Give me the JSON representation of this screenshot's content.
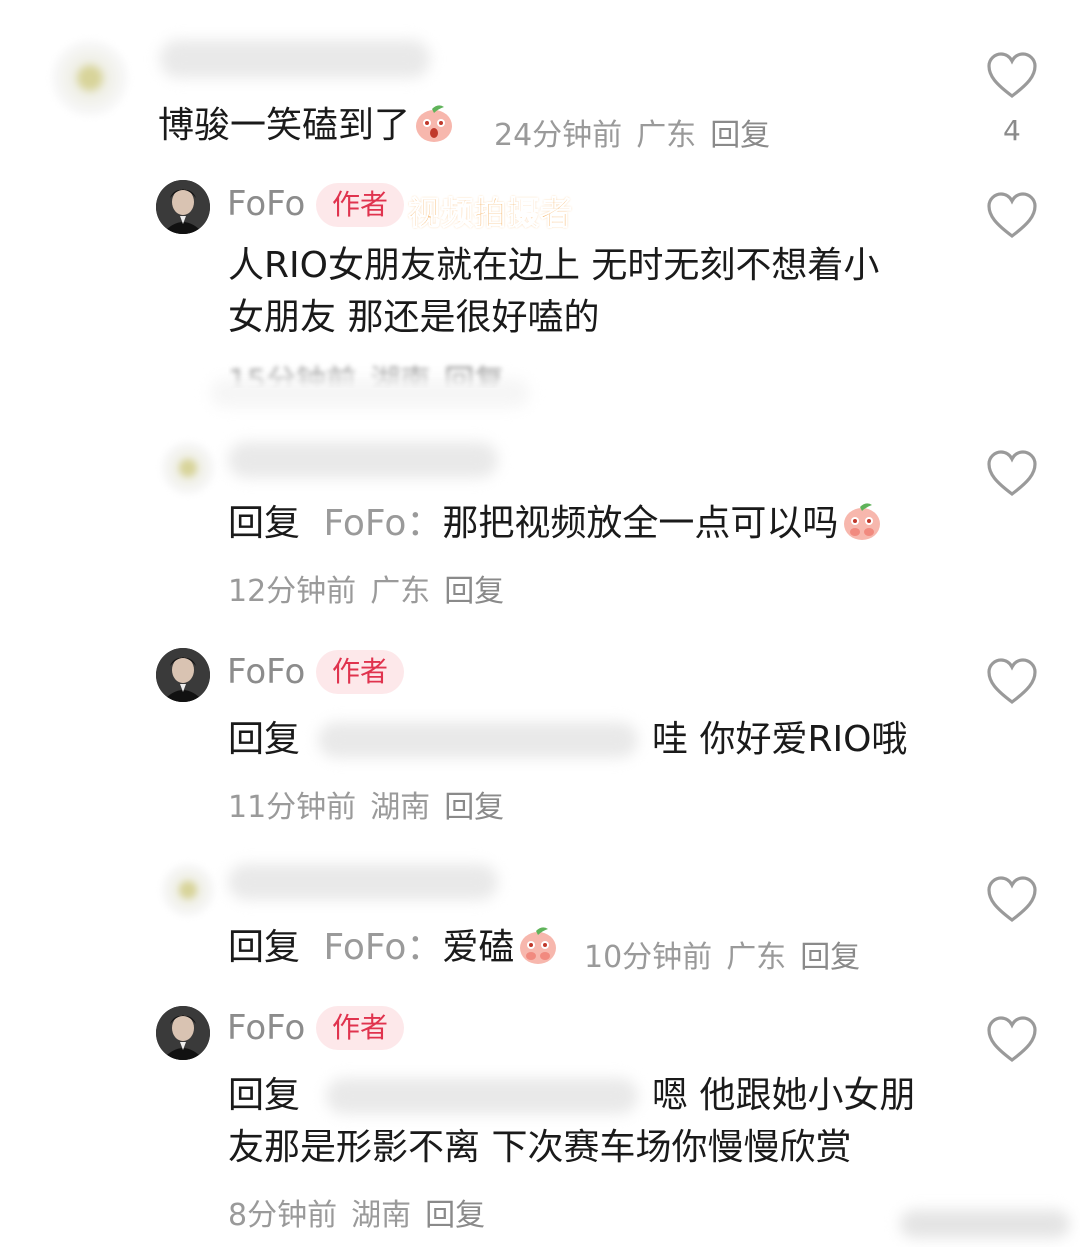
{
  "comments": [
    {
      "text": "博骏一笑磕到了",
      "time": "24分钟前",
      "region": "广东",
      "reply_label": "回复",
      "like_count": "4",
      "emoji": "peach-emoji"
    },
    {
      "author": "FoFo",
      "badge": "作者",
      "tag": "视频拍摄者",
      "text_line1": "人RIO女朋友就在边上 无时无刻不想着小",
      "text_line2": "女朋友 那还是很好嗑的",
      "time": "15分钟前",
      "region": "湖南",
      "reply_label": "回复"
    },
    {
      "reply_prefix": "回复",
      "reply_to": "FoFo：",
      "text": "那把视频放全一点可以吗",
      "time": "12分钟前",
      "region": "广东",
      "reply_label": "回复",
      "emoji": "peach-emoji"
    },
    {
      "author": "FoFo",
      "badge": "作者",
      "reply_prefix": "回复",
      "text": "哇 你好爱RIO哦",
      "time": "11分钟前",
      "region": "湖南",
      "reply_label": "回复"
    },
    {
      "reply_prefix": "回复",
      "reply_to": "FoFo：",
      "text": "爱磕",
      "time": "10分钟前",
      "region": "广东",
      "reply_label": "回复",
      "emoji": "peach-emoji"
    },
    {
      "author": "FoFo",
      "badge": "作者",
      "reply_prefix": "回复",
      "text_line1": "嗯 他跟她小女朋",
      "text_line2": "友那是形影不离 下次赛车场你慢慢欣赏",
      "time": "8分钟前",
      "region": "湖南",
      "reply_label": "回复"
    }
  ],
  "colors": {
    "author_badge_bg": "#fde8ea",
    "author_badge_text": "#e0334e",
    "orange_tag": "#f29d3a",
    "meta_gray": "#9a9a9a"
  }
}
